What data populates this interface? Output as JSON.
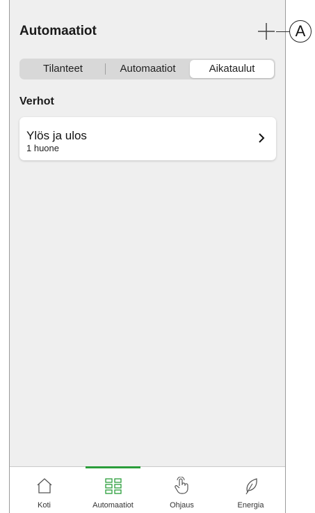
{
  "header": {
    "title": "Automaatiot"
  },
  "callout": {
    "label": "A"
  },
  "segments": [
    {
      "label": "Tilanteet",
      "active": false
    },
    {
      "label": "Automaatiot",
      "active": false
    },
    {
      "label": "Aikataulut",
      "active": true
    }
  ],
  "section": {
    "title": "Verhot"
  },
  "card": {
    "title": "Ylös ja ulos",
    "subtitle": "1 huone",
    "icon": "chevron-right-icon"
  },
  "tabs": [
    {
      "label": "Koti",
      "icon": "home-icon",
      "active": false
    },
    {
      "label": "Automaatiot",
      "icon": "grid-icon",
      "active": true
    },
    {
      "label": "Ohjaus",
      "icon": "hand-pointer-icon",
      "active": false
    },
    {
      "label": "Energia",
      "icon": "leaf-icon",
      "active": false
    }
  ],
  "colors": {
    "accent": "#2a9d3a",
    "background": "#efefef",
    "card": "#ffffff"
  }
}
